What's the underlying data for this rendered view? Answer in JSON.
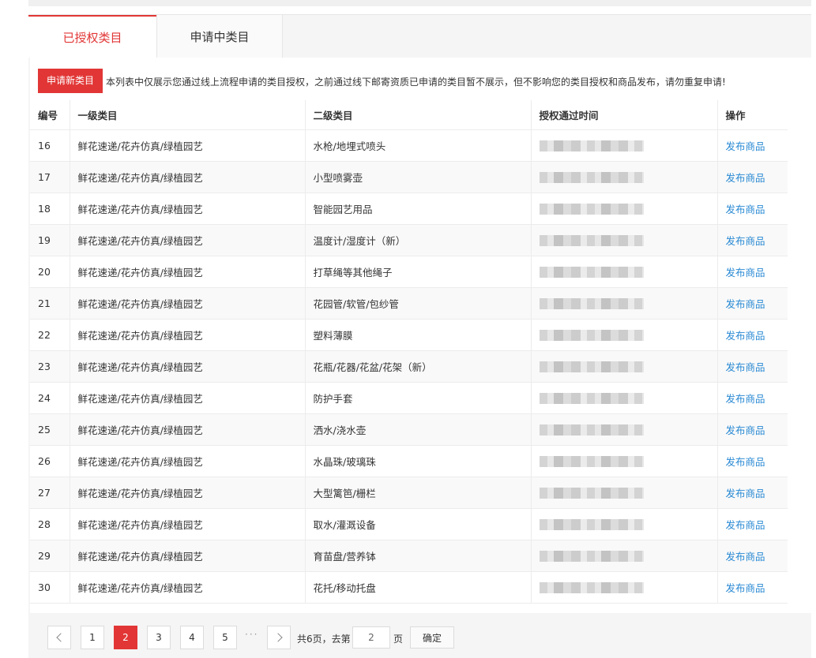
{
  "tabs": [
    {
      "label": "已授权类目",
      "active": true
    },
    {
      "label": "申请中类目",
      "active": false
    }
  ],
  "toolbar": {
    "apply_button": "申请新类目",
    "notice": "本列表中仅展示您通过线上流程申请的类目授权，之前通过线下邮寄资质已申请的类目暂不展示，但不影响您的类目授权和商品发布，请勿重复申请!"
  },
  "table": {
    "headers": [
      "编号",
      "一级类目",
      "二级类目",
      "授权通过时间",
      "操作"
    ],
    "rows": [
      {
        "id": "16",
        "level1": "鲜花速递/花卉仿真/绿植园艺",
        "level2": "水枪/地埋式喷头",
        "action": "发布商品"
      },
      {
        "id": "17",
        "level1": "鲜花速递/花卉仿真/绿植园艺",
        "level2": "小型喷雾壶",
        "action": "发布商品"
      },
      {
        "id": "18",
        "level1": "鲜花速递/花卉仿真/绿植园艺",
        "level2": "智能园艺用品",
        "action": "发布商品"
      },
      {
        "id": "19",
        "level1": "鲜花速递/花卉仿真/绿植园艺",
        "level2": "温度计/湿度计（新）",
        "action": "发布商品"
      },
      {
        "id": "20",
        "level1": "鲜花速递/花卉仿真/绿植园艺",
        "level2": "打草绳等其他绳子",
        "action": "发布商品"
      },
      {
        "id": "21",
        "level1": "鲜花速递/花卉仿真/绿植园艺",
        "level2": "花园管/软管/包纱管",
        "action": "发布商品"
      },
      {
        "id": "22",
        "level1": "鲜花速递/花卉仿真/绿植园艺",
        "level2": "塑料薄膜",
        "action": "发布商品"
      },
      {
        "id": "23",
        "level1": "鲜花速递/花卉仿真/绿植园艺",
        "level2": "花瓶/花器/花盆/花架（新）",
        "action": "发布商品"
      },
      {
        "id": "24",
        "level1": "鲜花速递/花卉仿真/绿植园艺",
        "level2": "防护手套",
        "action": "发布商品"
      },
      {
        "id": "25",
        "level1": "鲜花速递/花卉仿真/绿植园艺",
        "level2": "洒水/浇水壶",
        "action": "发布商品"
      },
      {
        "id": "26",
        "level1": "鲜花速递/花卉仿真/绿植园艺",
        "level2": "水晶珠/玻璃珠",
        "action": "发布商品"
      },
      {
        "id": "27",
        "level1": "鲜花速递/花卉仿真/绿植园艺",
        "level2": "大型篱笆/栅栏",
        "action": "发布商品"
      },
      {
        "id": "28",
        "level1": "鲜花速递/花卉仿真/绿植园艺",
        "level2": "取水/灌溉设备",
        "action": "发布商品"
      },
      {
        "id": "29",
        "level1": "鲜花速递/花卉仿真/绿植园艺",
        "level2": "育苗盘/营养钵",
        "action": "发布商品"
      },
      {
        "id": "30",
        "level1": "鲜花速递/花卉仿真/绿植园艺",
        "level2": "花托/移动托盘",
        "action": "发布商品"
      }
    ]
  },
  "pagination": {
    "pages": [
      "1",
      "2",
      "3",
      "4",
      "5"
    ],
    "current": "2",
    "ellipsis": "···",
    "total_text": "共6页，去第",
    "goto_value": "2",
    "page_unit": "页",
    "confirm": "确定"
  },
  "colors": {
    "accent": "#e23636",
    "link": "#2a8ad4"
  }
}
